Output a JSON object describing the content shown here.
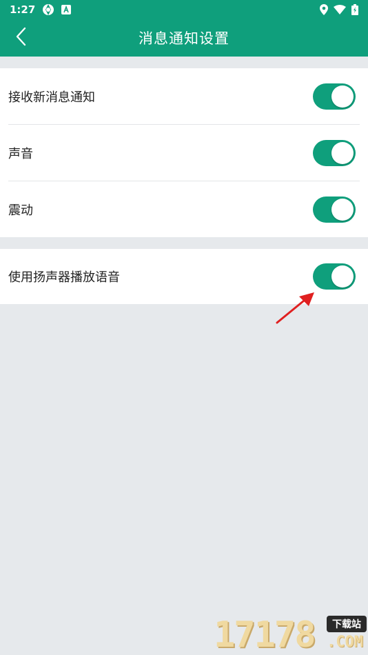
{
  "status_bar": {
    "time": "1:27",
    "icons_left": [
      "aperture-icon",
      "a-box-icon"
    ],
    "icons_right": [
      "location-icon",
      "wifi-icon",
      "battery-icon"
    ]
  },
  "app_bar": {
    "title": "消息通知设置",
    "back_icon": "chevron-left-icon"
  },
  "settings": {
    "group1": [
      {
        "label": "接收新消息通知",
        "enabled": true
      },
      {
        "label": "声音",
        "enabled": true
      },
      {
        "label": "震动",
        "enabled": true
      }
    ],
    "group2": [
      {
        "label": "使用扬声器播放语音",
        "enabled": true
      }
    ]
  },
  "watermark": {
    "digits": "17178",
    "badge": "下载站",
    "suffix": ".COM"
  },
  "colors": {
    "accent": "#0f9f7c",
    "background": "#e6e9ec",
    "annotation_arrow": "#e02020"
  }
}
